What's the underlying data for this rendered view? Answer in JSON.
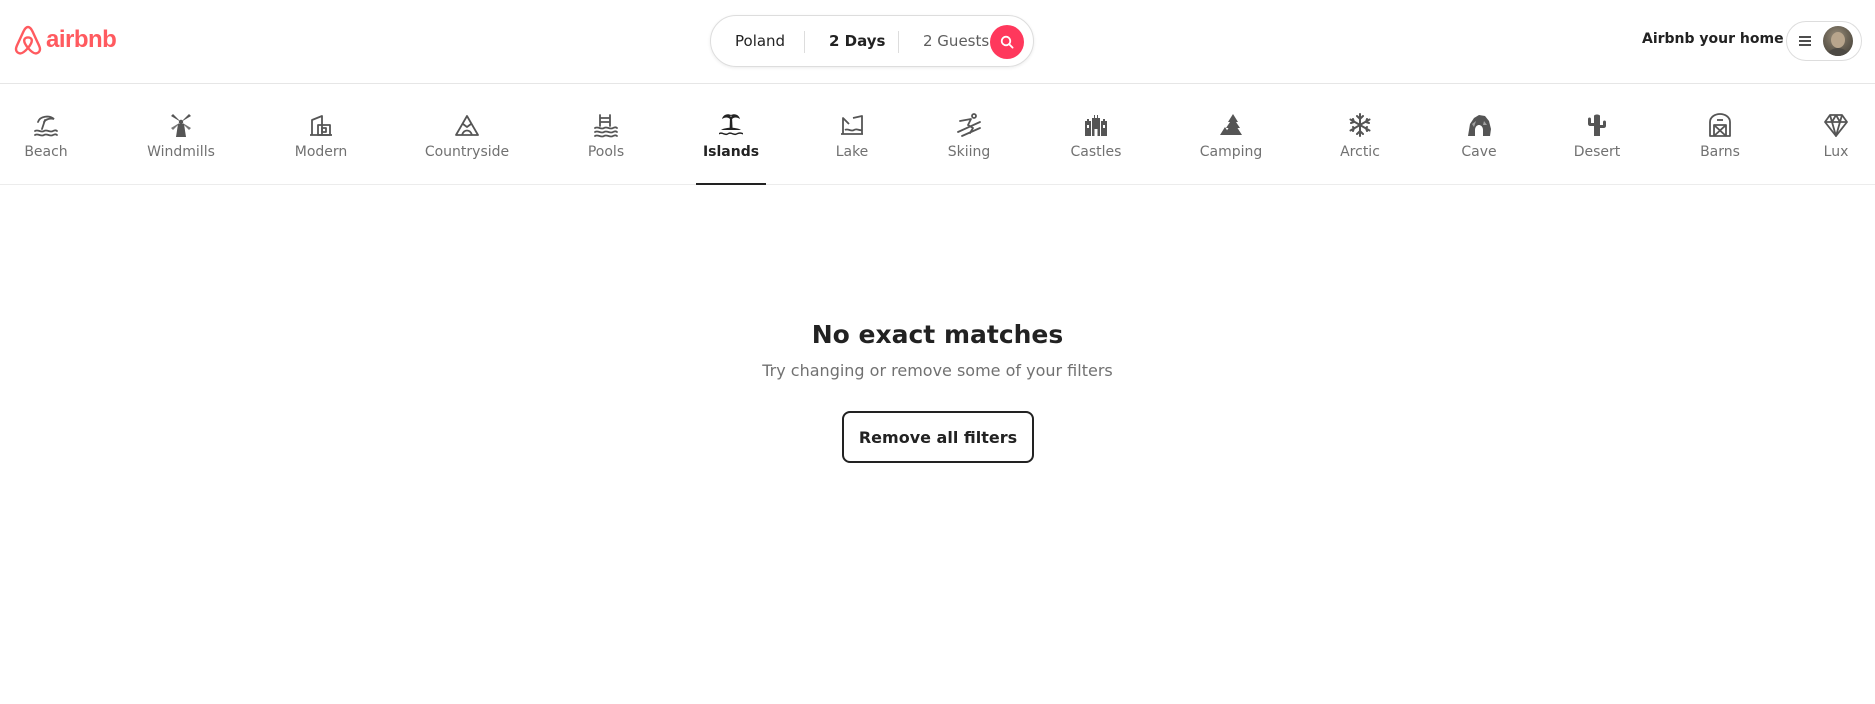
{
  "header": {
    "brand": "airbnb",
    "brand_color": "#ff5a5f",
    "search": {
      "location": "Poland",
      "dates": "2 Days",
      "guests": "2 Guests",
      "button_color": "#ff385c",
      "button_icon": "search-icon"
    },
    "host_link": "Airbnb your home",
    "user_menu": {
      "menu_icon": "hamburger-icon",
      "avatar": "user-avatar"
    }
  },
  "categories": [
    {
      "label": "Beach",
      "icon": "beach-icon"
    },
    {
      "label": "Windmills",
      "icon": "windmill-icon"
    },
    {
      "label": "Modern",
      "icon": "modern-icon"
    },
    {
      "label": "Countryside",
      "icon": "countryside-icon"
    },
    {
      "label": "Pools",
      "icon": "pool-icon"
    },
    {
      "label": "Islands",
      "icon": "island-icon",
      "active": true
    },
    {
      "label": "Lake",
      "icon": "lake-icon"
    },
    {
      "label": "Skiing",
      "icon": "skiing-icon"
    },
    {
      "label": "Castles",
      "icon": "castle-icon"
    },
    {
      "label": "Camping",
      "icon": "camping-icon"
    },
    {
      "label": "Arctic",
      "icon": "arctic-icon"
    },
    {
      "label": "Cave",
      "icon": "cave-icon"
    },
    {
      "label": "Desert",
      "icon": "desert-icon"
    },
    {
      "label": "Barns",
      "icon": "barn-icon"
    },
    {
      "label": "Lux",
      "icon": "lux-icon"
    }
  ],
  "empty_state": {
    "title": "No exact matches",
    "subtitle": "Try changing or remove some of your filters",
    "button": "Remove all filters"
  }
}
